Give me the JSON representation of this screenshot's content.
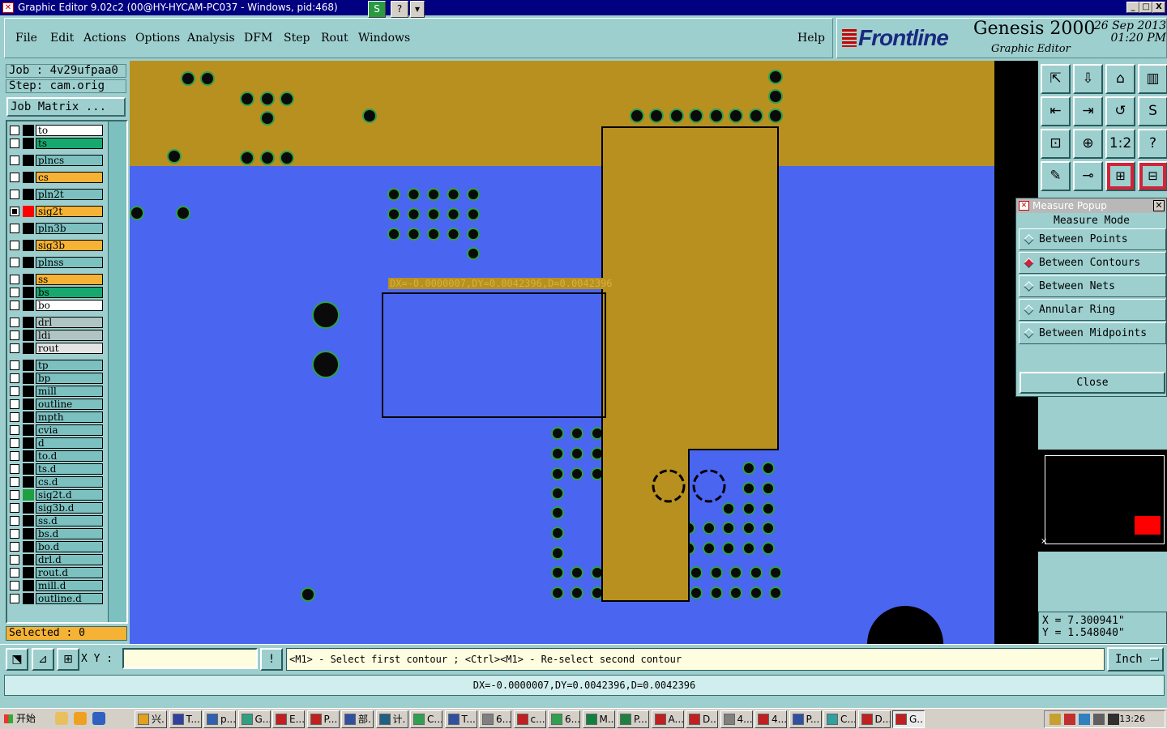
{
  "window": {
    "title": "Graphic Editor 9.02c2 (00@HY-HYCAM-PC037 - Windows, pid:468)",
    "buttons": [
      "S",
      "?",
      "▾"
    ],
    "controls": [
      "_",
      "□",
      "X"
    ]
  },
  "menu": [
    "File",
    "Edit",
    "Actions",
    "Options",
    "Analysis",
    "DFM",
    "Step",
    "Rout",
    "Windows"
  ],
  "help": "Help",
  "logo": {
    "brand": "Frontline",
    "product": "Genesis 2000",
    "subtitle": "Graphic Editor",
    "date": "26 Sep 2013",
    "time": "01:20 PM"
  },
  "job": {
    "job": "Job : 4v29ufpaa0",
    "step": "Step: cam.orig",
    "matrix_button": "Job Matrix ..."
  },
  "layers": [
    {
      "name": "to",
      "bg": "#ffffff",
      "swatch": "#000000",
      "checked": false,
      "mark": ""
    },
    {
      "name": "ts",
      "bg": "#17a870",
      "swatch": "#000000",
      "checked": false,
      "mark": "⬋"
    },
    {
      "name": "plncs",
      "bg": "#7cc0c0",
      "swatch": "#000000",
      "checked": false,
      "mark": ""
    },
    {
      "name": "cs",
      "bg": "#f5b235",
      "swatch": "#000000",
      "checked": false,
      "mark": "⬋"
    },
    {
      "name": "pln2t",
      "bg": "#7cc0c0",
      "swatch": "#000000",
      "checked": false,
      "mark": ""
    },
    {
      "name": "sig2t",
      "bg": "#f5b235",
      "swatch": "#ff0000",
      "checked": true,
      "mark": "⬋ ⊞"
    },
    {
      "name": "pln3b",
      "bg": "#7cc0c0",
      "swatch": "#000000",
      "checked": false,
      "mark": ""
    },
    {
      "name": "sig3b",
      "bg": "#f5b235",
      "swatch": "#000000",
      "checked": false,
      "mark": "⬋"
    },
    {
      "name": "plnss",
      "bg": "#7cc0c0",
      "swatch": "#000000",
      "checked": false,
      "mark": ""
    },
    {
      "name": "ss",
      "bg": "#f5b235",
      "swatch": "#000000",
      "checked": false,
      "mark": "⬋"
    },
    {
      "name": "bs",
      "bg": "#17a870",
      "swatch": "#000000",
      "checked": false,
      "mark": "⬋"
    },
    {
      "name": "bo",
      "bg": "#ffffff",
      "swatch": "#000000",
      "checked": false,
      "mark": ""
    },
    {
      "name": "drl",
      "bg": "#b0c4c4",
      "swatch": "#000000",
      "checked": false,
      "mark": ""
    },
    {
      "name": "ldi",
      "bg": "#b0c4c4",
      "swatch": "#000000",
      "checked": false,
      "mark": ""
    },
    {
      "name": "rout",
      "bg": "#e4e4e4",
      "swatch": "#000000",
      "checked": false,
      "mark": ""
    },
    {
      "name": "tp",
      "bg": "#7cc0c0",
      "swatch": "#000000",
      "checked": false,
      "mark": ""
    },
    {
      "name": "bp",
      "bg": "#7cc0c0",
      "swatch": "#000000",
      "checked": false,
      "mark": ""
    },
    {
      "name": "mill",
      "bg": "#7cc0c0",
      "swatch": "#000000",
      "checked": false,
      "mark": ""
    },
    {
      "name": "outline",
      "bg": "#7cc0c0",
      "swatch": "#000000",
      "checked": false,
      "mark": "⬋"
    },
    {
      "name": "mpth",
      "bg": "#7cc0c0",
      "swatch": "#000000",
      "checked": false,
      "mark": ""
    },
    {
      "name": "cvia",
      "bg": "#7cc0c0",
      "swatch": "#000000",
      "checked": false,
      "mark": ""
    },
    {
      "name": "d",
      "bg": "#7cc0c0",
      "swatch": "#000000",
      "checked": false,
      "mark": ""
    },
    {
      "name": "to.d",
      "bg": "#7cc0c0",
      "swatch": "#000000",
      "checked": false,
      "mark": ""
    },
    {
      "name": "ts.d",
      "bg": "#7cc0c0",
      "swatch": "#000000",
      "checked": false,
      "mark": "⬋"
    },
    {
      "name": "cs.d",
      "bg": "#7cc0c0",
      "swatch": "#000000",
      "checked": false,
      "mark": "⬋"
    },
    {
      "name": "sig2t.d",
      "bg": "#7cc0c0",
      "swatch": "#1fa040",
      "checked": false,
      "mark": "⬋"
    },
    {
      "name": "sig3b.d",
      "bg": "#7cc0c0",
      "swatch": "#000000",
      "checked": false,
      "mark": "⬋"
    },
    {
      "name": "ss.d",
      "bg": "#7cc0c0",
      "swatch": "#000000",
      "checked": false,
      "mark": "⬋"
    },
    {
      "name": "bs.d",
      "bg": "#7cc0c0",
      "swatch": "#000000",
      "checked": false,
      "mark": "⬋"
    },
    {
      "name": "bo.d",
      "bg": "#7cc0c0",
      "swatch": "#000000",
      "checked": false,
      "mark": ""
    },
    {
      "name": "drl.d",
      "bg": "#7cc0c0",
      "swatch": "#000000",
      "checked": false,
      "mark": ""
    },
    {
      "name": "rout.d",
      "bg": "#7cc0c0",
      "swatch": "#000000",
      "checked": false,
      "mark": ""
    },
    {
      "name": "mill.d",
      "bg": "#7cc0c0",
      "swatch": "#000000",
      "checked": false,
      "mark": ""
    },
    {
      "name": "outline.d",
      "bg": "#7cc0c0",
      "swatch": "#000000",
      "checked": false,
      "mark": "⬋"
    }
  ],
  "selected": "Selected : 0",
  "canvas": {
    "measure_label": "DX=-0.0000007,DY=0.0042396,D=0.0042396",
    "colors": {
      "board": "#4a66f0",
      "copper": "#b8901f",
      "pad": "#0a0a0a",
      "pad_ring": "#2ea04a"
    }
  },
  "tools": [
    "⇱",
    "⇩",
    "⌂",
    "▥",
    "⇤",
    "⇥",
    "↺",
    "S",
    "⊡",
    "⊕",
    "1:2",
    "?",
    "✎",
    "⊸",
    "⊞",
    "⊟"
  ],
  "measure_popup": {
    "title": "Measure Popup",
    "header": "Measure Mode",
    "options": [
      {
        "label": "Between Points",
        "selected": false
      },
      {
        "label": "Between Contours",
        "selected": true
      },
      {
        "label": "Between Nets",
        "selected": false
      },
      {
        "label": "Annular Ring",
        "selected": false
      },
      {
        "label": "Between Midpoints",
        "selected": false
      }
    ],
    "close": "Close"
  },
  "coords": {
    "x": "X = 7.300941\"",
    "y": "Y = 1.548040\""
  },
  "bottom": {
    "xy_label": "X Y :",
    "xy_value": "",
    "prompt": "<M1> - Select first contour ; <Ctrl><M1> - Re-select second contour",
    "units": "Inch",
    "status": "DX=-0.0000007,DY=0.0042396,D=0.0042396"
  },
  "taskbar": {
    "start": "开始",
    "tasks": [
      "兴.",
      "T...",
      "p...",
      "G...",
      "E...",
      "P...",
      "部.",
      "计.",
      "C...",
      "T...",
      "6...",
      "c...",
      "6...",
      "M...",
      "P...",
      "A...",
      "D...",
      "4...",
      "4...",
      "P...",
      "C...",
      "D...",
      "G..."
    ],
    "clock": "13:26"
  }
}
